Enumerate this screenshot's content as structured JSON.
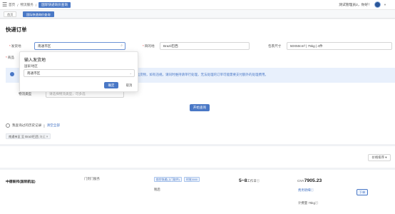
{
  "topbar": {
    "breadcrumbs": [
      "首页",
      "/",
      "物流服务",
      "/",
      "国际快递询价查询"
    ],
    "user_name": "测试管理员2，你好！"
  },
  "tabs": [
    "首页",
    "国际快递询价查询"
  ],
  "page_title": "快递订单",
  "form": {
    "origin_label": "发货地",
    "origin_value": "南通市区",
    "dest_label": "目的地",
    "dest_value": "Brazil巴西",
    "package_label": "包裹尺寸",
    "package_value": "50X50cm³ | 75kg | 4件",
    "row2_label": "商品",
    "logistics_label": "物流类型",
    "logistics_placeholder": "请选择物流类型，可多选"
  },
  "notice_text": "不实发运货物，如有违规，请同时维持请单行处理，无法处理的订单可能需要支付额外的处理费用。",
  "query_button": "开始查询",
  "history": {
    "label": "我查询过的历史记录",
    "clear_label": "清空全部",
    "tag_text": "南通市区 至 Brazil巴西",
    "tag_meta": "海运"
  },
  "sort_label": "价格排序 ▾",
  "result": {
    "carrier": "中德联邦(国际航运)",
    "service_type": "门到门服务",
    "tag1": "航空快递(上门取件)",
    "tag2": "时效3000",
    "extra": "税后",
    "transit": "5~8",
    "transit_unit": "工作日",
    "currency": "CNY",
    "price": "7905.23",
    "detail_link": "费用明细",
    "weight": "计费量 75kg",
    "order_button": "下单"
  },
  "popover": {
    "title": "输入发货地",
    "subtitle": "国家/地区",
    "select_value": "南通市区",
    "ok_label": "确定",
    "cancel_label": "取消"
  },
  "colors": {
    "accent": "#4a78c6",
    "notice_bg": "#e8f0fc",
    "page_bg": "#f0f2f5"
  }
}
